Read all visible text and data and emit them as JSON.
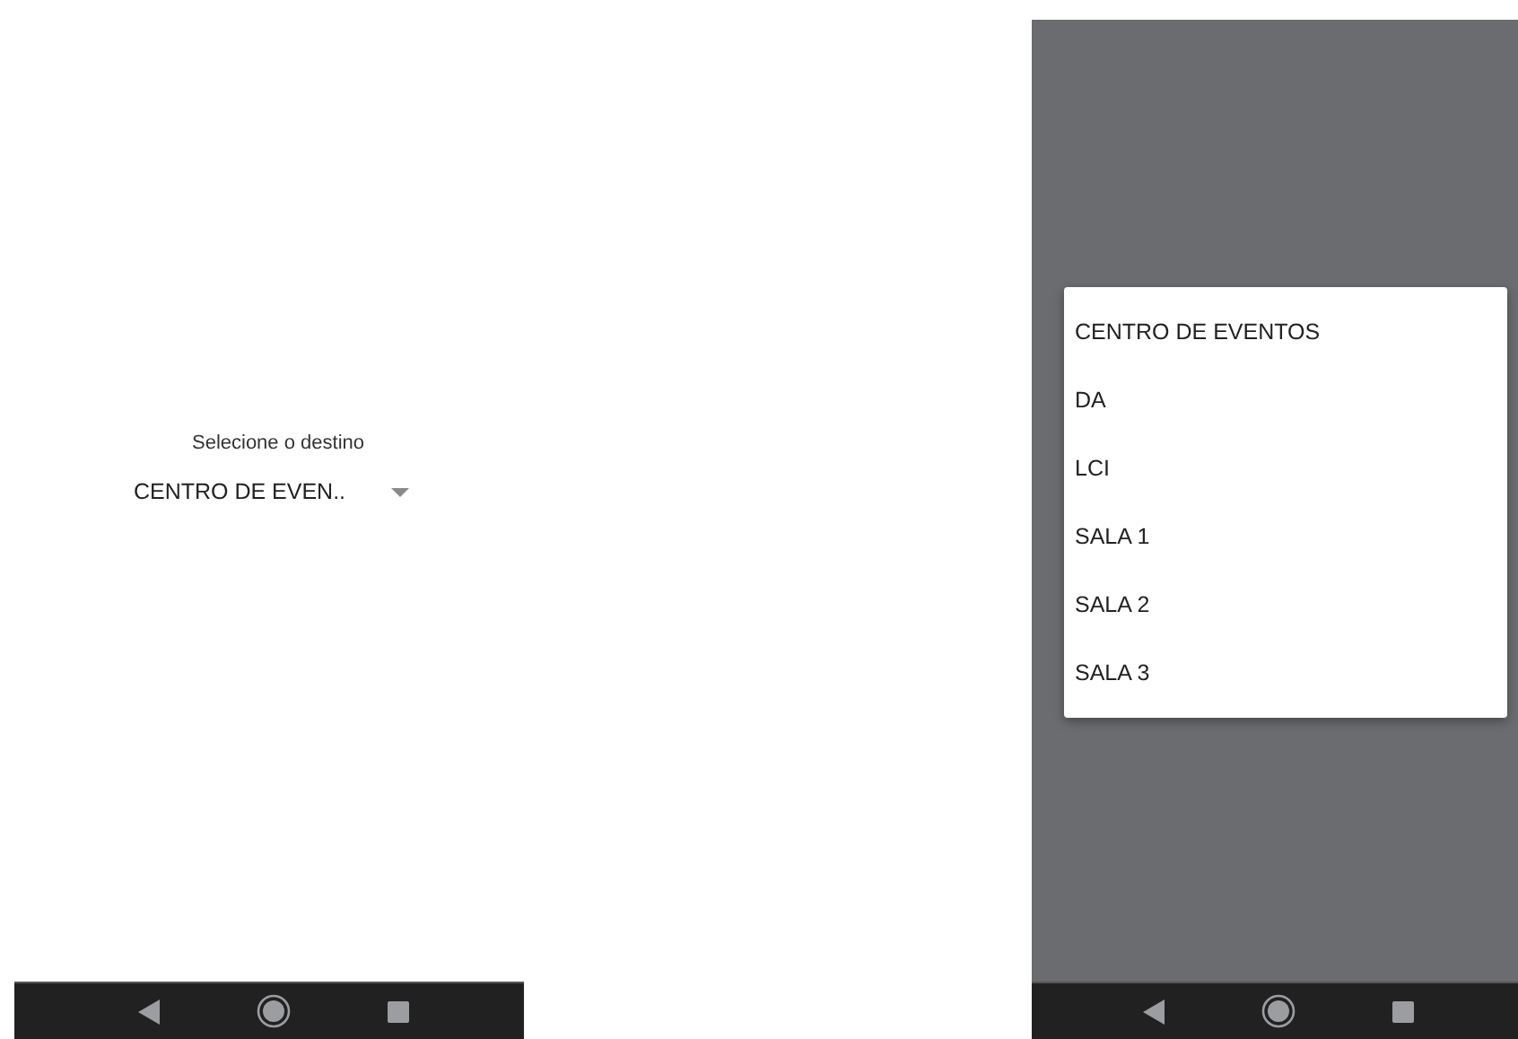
{
  "form_screen": {
    "label": "Selecione o destino",
    "spinner": {
      "value": "CENTRO DE EVEN.."
    }
  },
  "dropdown_screen": {
    "options": [
      {
        "label": "CENTRO DE EVENTOS"
      },
      {
        "label": "DA"
      },
      {
        "label": "LCI"
      },
      {
        "label": "SALA 1"
      },
      {
        "label": "SALA 2"
      },
      {
        "label": "SALA 3"
      }
    ]
  }
}
